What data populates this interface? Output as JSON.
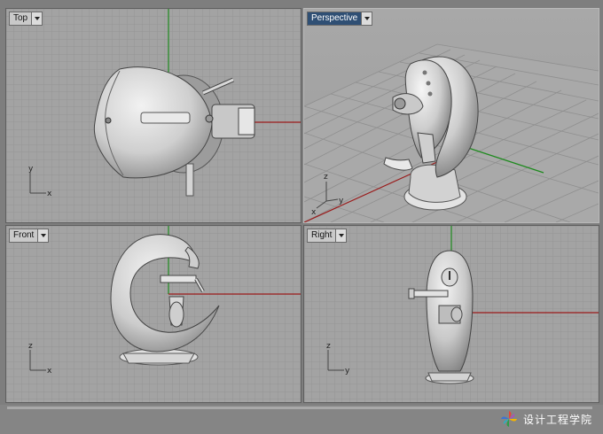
{
  "viewports": {
    "top": {
      "label": "Top",
      "axis_x": "x",
      "axis_y": "y"
    },
    "perspective": {
      "label": "Perspective",
      "axis_x": "x",
      "axis_y": "y",
      "axis_z": "z"
    },
    "front": {
      "label": "Front",
      "axis_x": "x",
      "axis_z": "z"
    },
    "right": {
      "label": "Right",
      "axis_y": "y",
      "axis_z": "z"
    }
  },
  "active_viewport": "perspective",
  "icons": {
    "dropdown": "chevron-down-icon",
    "watermark": "pinwheel-logo-icon"
  },
  "colors": {
    "viewport_bg": "#a3a3a3",
    "grid_minor": "#959595",
    "grid_major": "#8a8a8a",
    "x_axis": "#9a1a1a",
    "y_axis": "#1e8a1e",
    "active_tab": "#2f4f74",
    "model": "#d8d8d8"
  },
  "watermark": {
    "text": "设计工程学院"
  }
}
